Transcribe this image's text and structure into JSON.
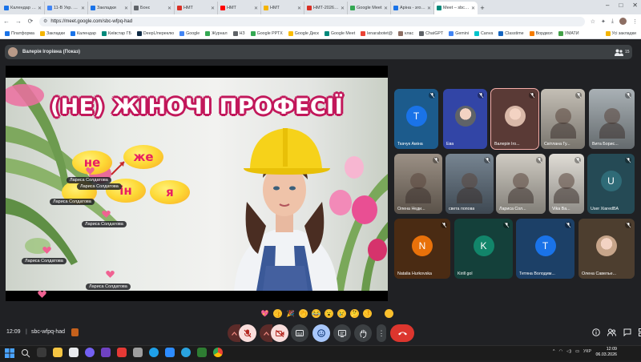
{
  "browser": {
    "tabs": [
      {
        "label": "Календар Google",
        "color": "#1a73e8",
        "active": false
      },
      {
        "label": "11-В Укр. мова",
        "color": "#4285f4",
        "active": false
      },
      {
        "label": "Закладки",
        "color": "#1a73e8",
        "active": false
      },
      {
        "label": "Бонс",
        "color": "#5f6368",
        "active": false
      },
      {
        "label": "НМТ",
        "color": "#d93025",
        "active": false
      },
      {
        "label": "НМТ",
        "color": "#ff0000",
        "active": false
      },
      {
        "label": "НМТ",
        "color": "#f4b400",
        "active": false
      },
      {
        "label": "НМТ-2026_04.03.2",
        "color": "#d93025",
        "active": false
      },
      {
        "label": "Google Meet",
        "color": "#34a853",
        "active": false
      },
      {
        "label": "Аріна - згор з уро",
        "color": "#1a73e8",
        "active": false
      },
      {
        "label": "Meet – sbc-wfpq",
        "color": "#00897b",
        "active": true
      }
    ],
    "url": "https://meet.google.com/sbc-wfpq-had",
    "bookmarks": [
      {
        "label": "Платформа",
        "color": "#1a73e8"
      },
      {
        "label": "Закладки",
        "color": "#f4b400"
      },
      {
        "label": "Календар",
        "color": "#1a73e8"
      },
      {
        "label": "Київстар ГБ",
        "color": "#00897b"
      },
      {
        "label": "DeepL/переклю",
        "color": "#0f2b46"
      },
      {
        "label": "Google",
        "color": "#4285f4"
      },
      {
        "label": "Журнал",
        "color": "#34a853"
      },
      {
        "label": "НЗ",
        "color": "#5f6368"
      },
      {
        "label": "Google РРТХ",
        "color": "#34a853"
      },
      {
        "label": "Google Диск",
        "color": "#fbbc04"
      },
      {
        "label": "Google Meet",
        "color": "#00897b"
      },
      {
        "label": "lenarabotet@",
        "color": "#ea4335"
      },
      {
        "label": "клас",
        "color": "#8d6e63"
      },
      {
        "label": "ChatGPT",
        "color": "#5f6368"
      },
      {
        "label": "Gemini",
        "color": "#4285f4"
      },
      {
        "label": "Canva",
        "color": "#00c4cc"
      },
      {
        "label": "Classtime",
        "color": "#1565c0"
      },
      {
        "label": "Вордвол",
        "color": "#f57c00"
      },
      {
        "label": "УМАТИ",
        "color": "#43a047"
      }
    ],
    "all_bookmarks_label": "Усі закладки"
  },
  "meet": {
    "presenter_label": "Валерія Ігорівна (Показ)",
    "people_count": "15",
    "slide": {
      "title": "(НЕ) ЖІНОЧІ ПРОФЕСІЇ",
      "bubbles": [
        "не",
        "же",
        "ін",
        "я"
      ]
    },
    "reactions": [
      {
        "name": "Лариса Солдатова"
      },
      {
        "name": "Лариса Солдатова"
      },
      {
        "name": "Лариса Солдатова"
      },
      {
        "name": "Лариса Солдатова"
      },
      {
        "name": "Лариса Солдатова"
      },
      {
        "name": "Лариса Солдатова"
      }
    ],
    "participants": [
      {
        "name": "Ткачук Аміна",
        "initial": "T",
        "bg": "#1c5b8c",
        "avatar": "#1a73e8"
      },
      {
        "name": "Ева",
        "initial": "",
        "bg": "#3245a6",
        "avatar": "#5f6368"
      },
      {
        "name": "Валерія Іго...",
        "initial": "",
        "bg": "#5a3a36",
        "avatar": "#d9b8a8"
      },
      {
        "name": "Світлана Гу...",
        "initial": "",
        "bg": "#b9b3a8",
        "avatar": ""
      },
      {
        "name": "Вита Борис...",
        "initial": "",
        "bg": "#9aa3a8",
        "avatar": ""
      },
      {
        "name": "Олена Неди...",
        "initial": "",
        "bg": "#8a7d70",
        "avatar": ""
      },
      {
        "name": "света попова",
        "initial": "",
        "bg": "#5f6f7e",
        "avatar": ""
      },
      {
        "name": "Лариса Сол...",
        "initial": "",
        "bg": "#c7c2b8",
        "avatar": ""
      },
      {
        "name": "Vika Ba...",
        "initial": "",
        "bg": "#dad6ce",
        "avatar": ""
      },
      {
        "name": "User XiaredBA",
        "initial": "U",
        "bg": "#254a55",
        "avatar": "#2f6b77"
      },
      {
        "name": "Natalia Hurkovska",
        "initial": "N",
        "bg": "#4a2b13",
        "avatar": "#e8710a"
      },
      {
        "name": "Kirill gol",
        "initial": "K",
        "bg": "#14403a",
        "avatar": "#12856a"
      },
      {
        "name": "Тетяна Володим...",
        "initial": "T",
        "bg": "#1c4067",
        "avatar": "#1a73e8"
      },
      {
        "name": "Олена Савелье...",
        "initial": "",
        "bg": "#4d3e2f",
        "avatar": "#c7a58a"
      }
    ],
    "clock": "12:09",
    "divider": "|",
    "meeting_code": "sbc-wfpq-had"
  },
  "taskbar": {
    "time": "12:09",
    "date": "06.03.2026",
    "lang": "УКР"
  }
}
